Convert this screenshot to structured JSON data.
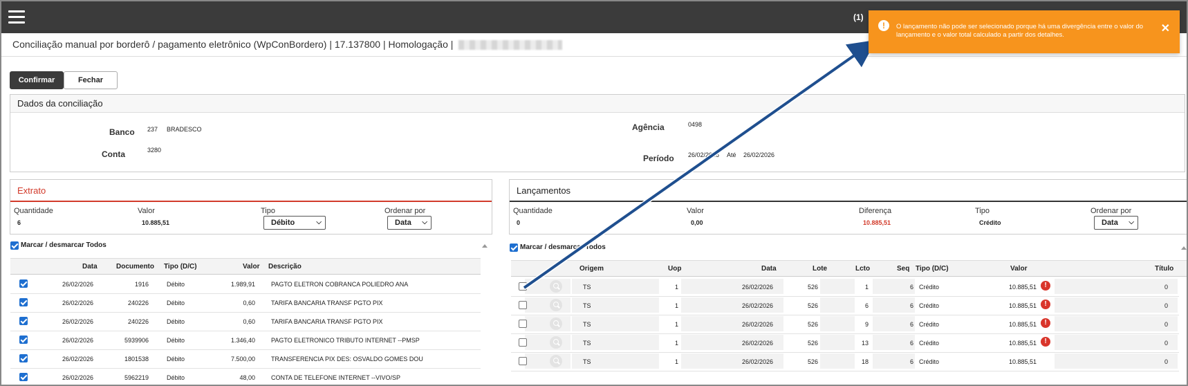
{
  "header": {
    "notification_count": "(1)"
  },
  "title": {
    "text": "Conciliação manual por borderô / pagamento eletrônico (WpConBordero) | 17.137800 | Homologação | "
  },
  "toolbar": {
    "confirm_label": "Confirmar",
    "close_label": "Fechar"
  },
  "conciliation": {
    "heading": "Dados da conciliação",
    "bank_label": "Banco",
    "bank_code": "237",
    "bank_name": "BRADESCO",
    "account_label": "Conta",
    "account_value": "3280",
    "agency_label": "Agência",
    "agency_value": "0498",
    "period_label": "Período",
    "period_from": "26/02/2026",
    "period_until_label": "Até",
    "period_to": "26/02/2026"
  },
  "extrato": {
    "heading": "Extrato",
    "qty_label": "Quantidade",
    "qty_value": "6",
    "value_label": "Valor",
    "value_value": "10.885,51",
    "type_label": "Tipo",
    "type_selected": "Débito",
    "order_label": "Ordenar por",
    "order_selected": "Data",
    "toggle_all_label": "Marcar / desmarcar Todos",
    "columns": [
      "Data",
      "Documento",
      "Tipo (D/C)",
      "Valor",
      "Descrição"
    ],
    "rows": [
      {
        "date": "26/02/2026",
        "doc": "1916",
        "type": "Débito",
        "value": "1.989,91",
        "desc": "PAGTO ELETRON COBRANCA POLIEDRO ANA"
      },
      {
        "date": "26/02/2026",
        "doc": "240226",
        "type": "Débito",
        "value": "0,60",
        "desc": "TARIFA BANCARIA TRANSF PGTO PIX"
      },
      {
        "date": "26/02/2026",
        "doc": "240226",
        "type": "Débito",
        "value": "0,60",
        "desc": "TARIFA BANCARIA TRANSF PGTO PIX"
      },
      {
        "date": "26/02/2026",
        "doc": "5939906",
        "type": "Débito",
        "value": "1.346,40",
        "desc": "PAGTO ELETRONICO TRIBUTO INTERNET --PMSP"
      },
      {
        "date": "26/02/2026",
        "doc": "1801538",
        "type": "Débito",
        "value": "7.500,00",
        "desc": "TRANSFERENCIA PIX DES: OSVALDO GOMES DOU"
      },
      {
        "date": "26/02/2026",
        "doc": "5962219",
        "type": "Débito",
        "value": "48,00",
        "desc": "CONTA DE TELEFONE INTERNET --VIVO/SP"
      }
    ]
  },
  "lancamentos": {
    "heading": "Lançamentos",
    "qty_label": "Quantidade",
    "qty_value": "0",
    "value_label": "Valor",
    "value_value": "0,00",
    "diff_label": "Diferença",
    "diff_value": "10.885,51",
    "type_label": "Tipo",
    "type_value": "Crédito",
    "order_label": "Ordenar por",
    "order_selected": "Data",
    "toggle_all_label": "Marcar / desmarcar Todos",
    "columns": [
      "Origem",
      "Uop",
      "Data",
      "Lote",
      "Lcto",
      "Seq",
      "Tipo (D/C)",
      "Valor",
      "Título"
    ],
    "rows": [
      {
        "origin": "TS",
        "uop": "1",
        "date": "26/02/2026",
        "lote": "526",
        "lcto": "1",
        "seq": "6",
        "type": "Crédito",
        "value": "10.885,51",
        "warn": true,
        "titulo": "0"
      },
      {
        "origin": "TS",
        "uop": "1",
        "date": "26/02/2026",
        "lote": "526",
        "lcto": "6",
        "seq": "6",
        "type": "Crédito",
        "value": "10.885,51",
        "warn": true,
        "titulo": "0"
      },
      {
        "origin": "TS",
        "uop": "1",
        "date": "26/02/2026",
        "lote": "526",
        "lcto": "9",
        "seq": "6",
        "type": "Crédito",
        "value": "10.885,51",
        "warn": true,
        "titulo": "0"
      },
      {
        "origin": "TS",
        "uop": "1",
        "date": "26/02/2026",
        "lote": "526",
        "lcto": "13",
        "seq": "6",
        "type": "Crédito",
        "value": "10.885,51",
        "warn": true,
        "titulo": "0"
      },
      {
        "origin": "TS",
        "uop": "1",
        "date": "26/02/2026",
        "lote": "526",
        "lcto": "18",
        "seq": "6",
        "type": "Crédito",
        "value": "10.885,51",
        "warn": false,
        "titulo": "0"
      }
    ]
  },
  "toast": {
    "message": "O lançamento não pode ser selecionado porque há uma divergência entre o valor do lançamento e o valor total calculado a partir dos detalhes.",
    "close_symbol": "✕"
  },
  "colors": {
    "accent_red": "#d23a2a",
    "toast_orange": "#f7941d",
    "checkbox_blue": "#1e6fd0",
    "arrow_blue": "#1f4f8f"
  }
}
